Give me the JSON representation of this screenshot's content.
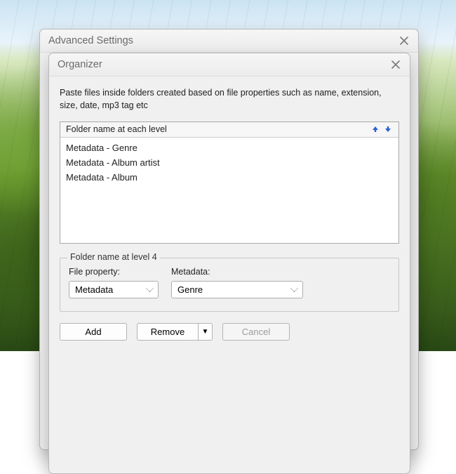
{
  "outer_window": {
    "title": "Advanced Settings"
  },
  "inner_window": {
    "title": "Organizer"
  },
  "description": "Paste files inside folders created based on file properties such as name, extension, size, date, mp3 tag etc",
  "level_list": {
    "header": "Folder name at each level",
    "items": [
      "Metadata - Genre",
      "Metadata - Album artist",
      "Metadata - Album"
    ]
  },
  "edit_group": {
    "legend": "Folder name at level 4",
    "property_label": "File property:",
    "metadata_label": "Metadata:",
    "property_value": "Metadata",
    "metadata_value": "Genre"
  },
  "buttons": {
    "add": "Add",
    "remove": "Remove",
    "cancel": "Cancel"
  }
}
